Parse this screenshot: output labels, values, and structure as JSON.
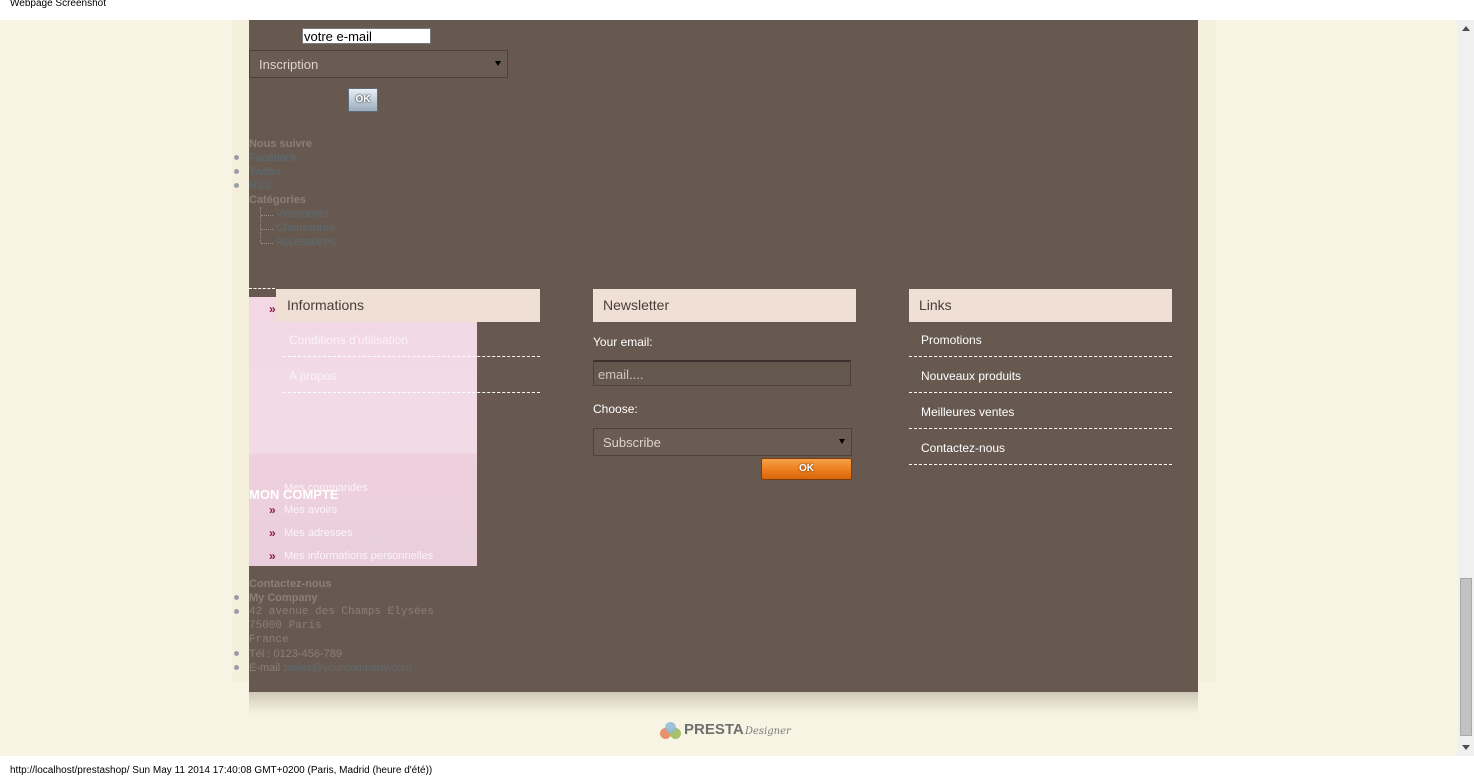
{
  "window": {
    "title": "Webpage Screenshot",
    "status": "http://localhost/prestashop/ Sun May 11 2014 17:40:08 GMT+0200 (Paris, Madrid (heure d'été))"
  },
  "top_newsletter": {
    "email_value": "votre e-mail",
    "select_value": "Inscription",
    "ok_label": "OK"
  },
  "follow": {
    "heading": "Nous suivre",
    "items": [
      "Facebook",
      "Twitter",
      "RSS"
    ]
  },
  "categories": {
    "heading": "Catégories",
    "items": [
      "Vêtements",
      "Chaussures",
      "Accessoires"
    ]
  },
  "informations": {
    "title": "Informations",
    "links": [
      "Conditions d'utilisation",
      "A propos"
    ]
  },
  "account": {
    "heading": "MON COMPTE",
    "links": [
      "Mes commandes",
      "Mes avoirs",
      "Mes adresses",
      "Mes informations personnelles"
    ]
  },
  "contact": {
    "heading": "Contactez-nous",
    "company": "My Company",
    "address": [
      "42 avenue des Champs Elysées",
      "75000 Paris",
      "France"
    ],
    "tel": "Tél : 0123-456-789",
    "email_label": "E-mail :",
    "email": "sales@yourcompany.com"
  },
  "newsletter": {
    "title": "Newsletter",
    "email_label": "Your email:",
    "email_placeholder": "email....",
    "choose_label": "Choose:",
    "select_value": "Subscribe",
    "ok_label": "OK"
  },
  "links": {
    "title": "Links",
    "items": [
      "Promotions",
      "Nouveaux produits",
      "Meilleures ventes",
      "Contactez-nous"
    ]
  },
  "logo": {
    "word": "PRESTA",
    "script": "Designer",
    "colors": [
      "#e8916a",
      "#a5c26a",
      "#8fb8d8"
    ]
  }
}
